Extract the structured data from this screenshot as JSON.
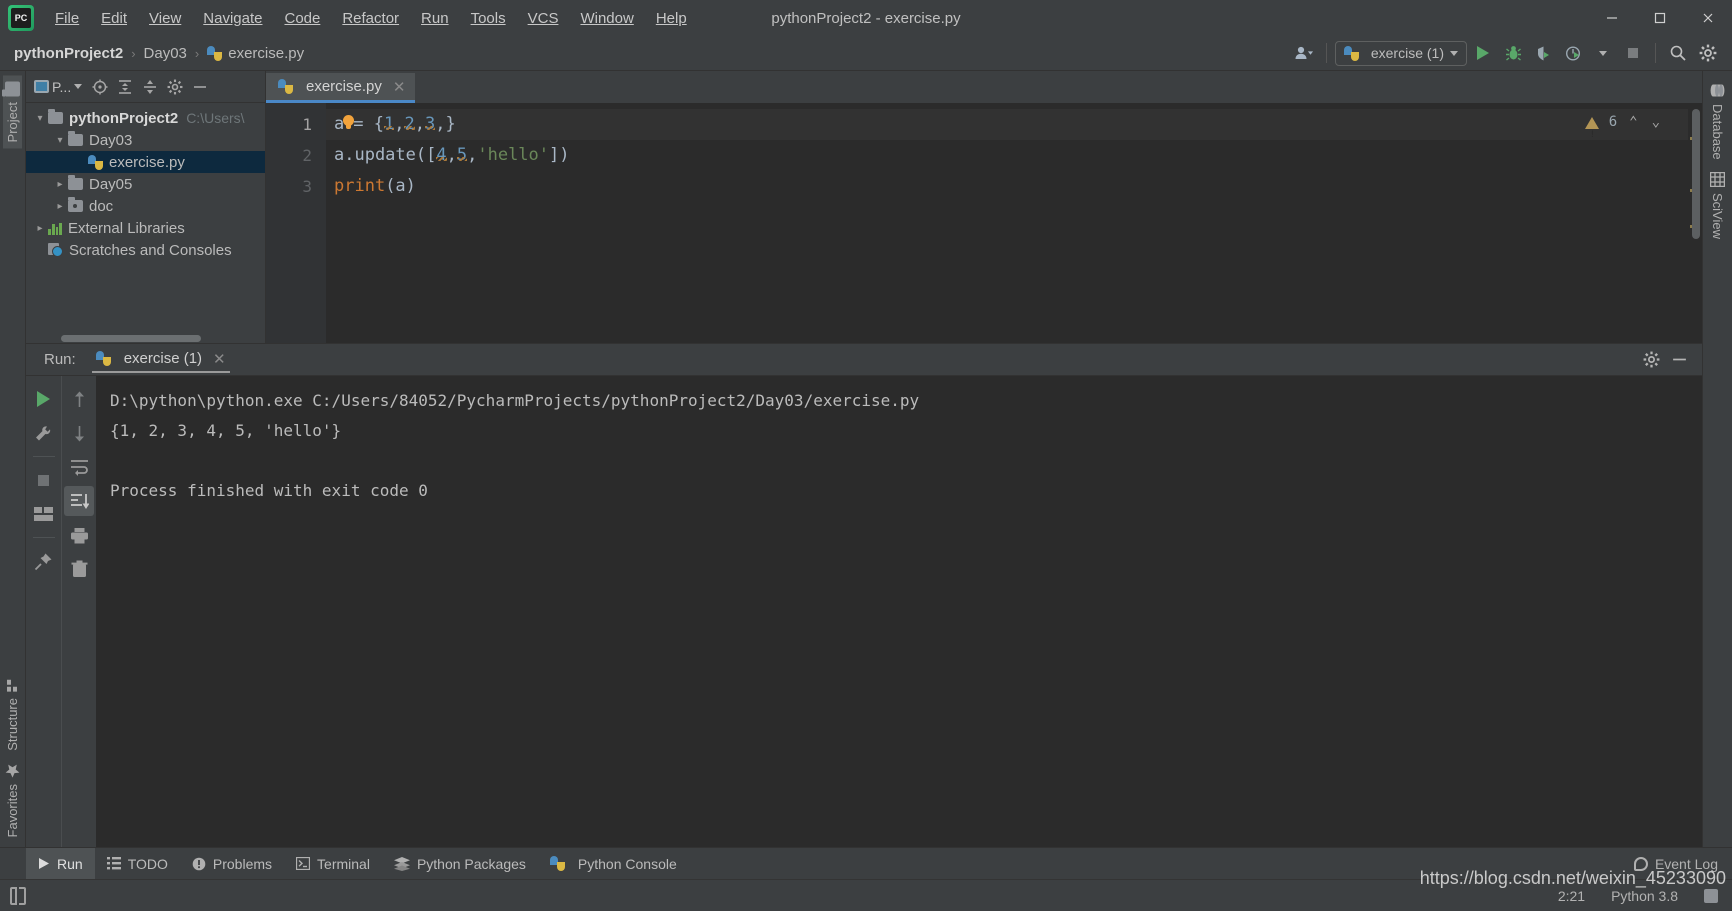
{
  "window": {
    "title": "pythonProject2 - exercise.py",
    "app_icon": "pycharm-logo",
    "minimize": "—",
    "maximize": "☐",
    "close": "✕"
  },
  "menubar": {
    "items": [
      {
        "label": "File"
      },
      {
        "label": "Edit"
      },
      {
        "label": "View"
      },
      {
        "label": "Navigate"
      },
      {
        "label": "Code"
      },
      {
        "label": "Refactor"
      },
      {
        "label": "Run"
      },
      {
        "label": "Tools"
      },
      {
        "label": "VCS"
      },
      {
        "label": "Window"
      },
      {
        "label": "Help"
      }
    ]
  },
  "navbar": {
    "breadcrumbs": [
      {
        "label": "pythonProject2"
      },
      {
        "label": "Day03"
      },
      {
        "label": "exercise.py"
      }
    ],
    "separator": "›",
    "run_config": "exercise (1)",
    "icons": {
      "user": "user-icon",
      "run": "run-icon",
      "debug": "debug-icon",
      "coverage": "run-coverage-icon",
      "profile": "profile-icon",
      "stop": "stop-icon",
      "search": "search-icon",
      "settings": "gear-icon"
    }
  },
  "left_stripe": {
    "top": [
      {
        "label": "Project",
        "icon": "folder-icon",
        "active": true
      }
    ],
    "bottom": [
      {
        "label": "Structure",
        "icon": "structure-icon"
      },
      {
        "label": "Favorites",
        "icon": "star-icon"
      }
    ]
  },
  "right_stripe": {
    "items": [
      {
        "label": "Database",
        "icon": "database-icon"
      },
      {
        "label": "SciView",
        "icon": "grid-icon"
      }
    ]
  },
  "project_pane": {
    "title": "P...",
    "toolbar_icons": [
      "target-icon",
      "expand-all-icon",
      "collapse-all-icon",
      "gear-icon",
      "hide-icon"
    ],
    "tree": [
      {
        "label": "pythonProject2",
        "path": "C:\\Users\\",
        "depth": 0,
        "type": "folder",
        "expanded": true,
        "bold": true,
        "selected": false
      },
      {
        "label": "Day03",
        "path": "",
        "depth": 1,
        "type": "folder",
        "expanded": true,
        "bold": false,
        "selected": false
      },
      {
        "label": "exercise.py",
        "path": "",
        "depth": 2,
        "type": "python-file",
        "expanded": null,
        "bold": false,
        "selected": true
      },
      {
        "label": "Day05",
        "path": "",
        "depth": 1,
        "type": "folder",
        "expanded": false,
        "bold": false,
        "selected": false
      },
      {
        "label": "doc",
        "path": "",
        "depth": 1,
        "type": "folder-dot",
        "expanded": false,
        "bold": false,
        "selected": false
      },
      {
        "label": "External Libraries",
        "path": "",
        "depth": 0,
        "type": "library",
        "expanded": false,
        "bold": false,
        "selected": false
      },
      {
        "label": "Scratches and Consoles",
        "path": "",
        "depth": 0,
        "type": "scratch",
        "expanded": null,
        "bold": false,
        "selected": false
      }
    ]
  },
  "editor": {
    "tab": {
      "label": "exercise.py",
      "icon": "python-file-icon",
      "close": "✕"
    },
    "line_numbers": [
      "1",
      "2",
      "3"
    ],
    "lines": [
      {
        "number": "1",
        "text": "a = {1,2,3,}",
        "highlighted": true,
        "has_bulb": true
      },
      {
        "number": "2",
        "text": "a.update([4,5,'hello'])",
        "highlighted": false,
        "has_bulb": false
      },
      {
        "number": "3",
        "text": "print(a)",
        "highlighted": false,
        "has_bulb": false
      }
    ],
    "inspection": {
      "icon": "warning-triangle-icon",
      "count": "6",
      "prev": "⌃",
      "next": "⌄"
    }
  },
  "run_window": {
    "label": "Run:",
    "tab": {
      "label": "exercise (1)",
      "icon": "python-icon",
      "close": "✕"
    },
    "header_icons": [
      "gear-icon",
      "hide-icon"
    ],
    "toolbar_left": [
      "rerun-icon",
      "wrench-icon",
      "stop-icon",
      "layout-icon",
      "pin-icon"
    ],
    "toolbar_right": [
      "up-icon",
      "down-icon",
      "soft-wrap-icon",
      "scroll-to-end-icon",
      "print-icon",
      "trash-icon"
    ],
    "console": [
      "D:\\python\\python.exe C:/Users/84052/PycharmProjects/pythonProject2/Day03/exercise.py",
      "{1, 2, 3, 4, 5, 'hello'}",
      "",
      "Process finished with exit code 0"
    ]
  },
  "statusbar": {
    "tabs": [
      {
        "label": "Run",
        "icon": "run-icon",
        "active": true
      },
      {
        "label": "TODO",
        "icon": "list-icon",
        "active": false
      },
      {
        "label": "Problems",
        "icon": "problems-icon",
        "active": false
      },
      {
        "label": "Terminal",
        "icon": "terminal-icon",
        "active": false
      },
      {
        "label": "Python Packages",
        "icon": "packages-icon",
        "active": false
      },
      {
        "label": "Python Console",
        "icon": "python-icon",
        "active": false
      }
    ],
    "event_log": "Event Log",
    "caret_position": "2:21",
    "interpreter": "Python 3.8"
  },
  "watermark": "https://blog.csdn.net/weixin_45233090",
  "colors": {
    "accent_green": "#59a869",
    "tab_underline": "#4a88c7",
    "selection": "#0d293e",
    "editor_bg": "#2b2b2b",
    "chrome_bg": "#3c3f41"
  }
}
